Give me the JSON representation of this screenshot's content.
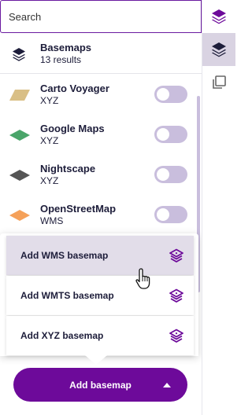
{
  "search": {
    "placeholder": "Search"
  },
  "header": {
    "title": "Basemaps",
    "subtitle": "13 results",
    "icon": "layers-icon"
  },
  "basemaps": [
    {
      "name": "Carto Voyager",
      "type": "XYZ",
      "color": "#d9bf86",
      "enabled": false
    },
    {
      "name": "Google Maps",
      "type": "XYZ",
      "color": "#4aa56a",
      "enabled": false
    },
    {
      "name": "Nightscape",
      "type": "XYZ",
      "color": "#555555",
      "enabled": false
    },
    {
      "name": "OpenStreetMap",
      "type": "WMS",
      "color": "#f5a15a",
      "enabled": false
    }
  ],
  "add_menu": {
    "items": [
      {
        "label": "Add WMS basemap",
        "icon": "layers-add-icon",
        "hovered": true
      },
      {
        "label": "Add WMTS basemap",
        "icon": "layers-add-icon",
        "hovered": false
      },
      {
        "label": "Add XYZ basemap",
        "icon": "layers-add-icon",
        "hovered": false
      }
    ]
  },
  "add_button": {
    "label": "Add basemap",
    "icon": "caret-up-icon"
  },
  "rail": [
    {
      "icon": "layers-icon",
      "active": false
    },
    {
      "icon": "layers-icon",
      "active": true
    },
    {
      "icon": "copy-icon",
      "active": false
    }
  ],
  "colors": {
    "accent": "#6d0a9a",
    "toggle_off": "#c9bedd",
    "hover_bg": "#e2dde9"
  }
}
